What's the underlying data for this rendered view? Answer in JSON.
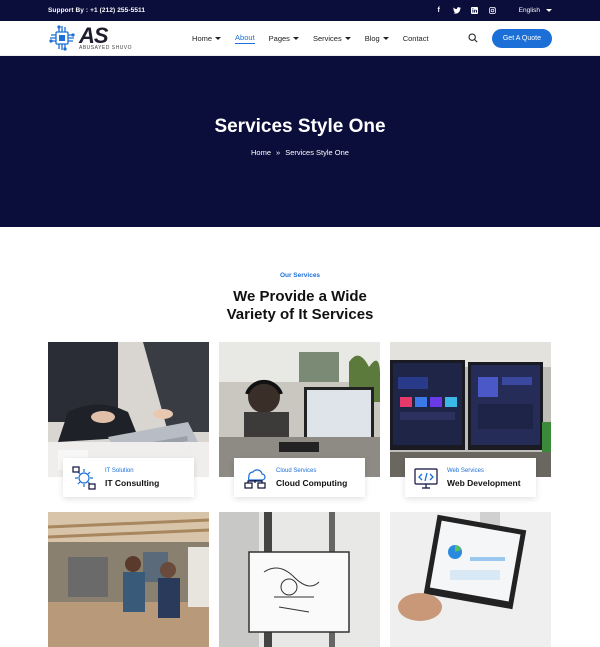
{
  "topbar": {
    "support": "Support By : +1 (212) 255-5511",
    "social": [
      "facebook-icon",
      "twitter-icon",
      "linkedin-icon",
      "instagram-icon"
    ],
    "language": "English"
  },
  "header": {
    "logo_big": "AS",
    "logo_small": "ABUSAYED SHUVO",
    "nav": [
      {
        "label": "Home",
        "dropdown": true
      },
      {
        "label": "About",
        "dropdown": false,
        "active": true
      },
      {
        "label": "Pages",
        "dropdown": true
      },
      {
        "label": "Services",
        "dropdown": true
      },
      {
        "label": "Blog",
        "dropdown": true
      },
      {
        "label": "Contact",
        "dropdown": false
      }
    ],
    "quote_button": "Get A Quote"
  },
  "hero": {
    "title": "Services Style One",
    "breadcrumb_home": "Home",
    "breadcrumb_sep": "»",
    "breadcrumb_current": "Services Style One"
  },
  "services": {
    "eyebrow": "Our Services",
    "headline_line1": "We Provide a Wide",
    "headline_line2": "Variety of It Services",
    "cards": [
      {
        "category": "IT Solution",
        "name": "IT Consulting"
      },
      {
        "category": "Cloud Services",
        "name": "Cloud Computing"
      },
      {
        "category": "Web Services",
        "name": "Web Development"
      }
    ]
  },
  "colors": {
    "navy": "#0b0d3a",
    "accent": "#1b6fd6"
  }
}
